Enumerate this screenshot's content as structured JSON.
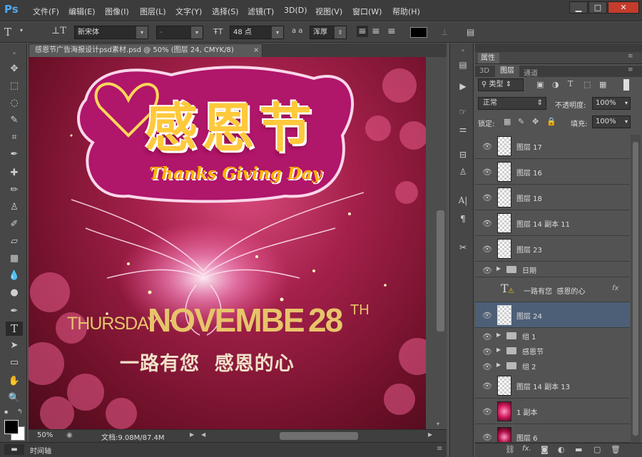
{
  "app": {
    "logo": "Ps"
  },
  "menu": [
    "文件(F)",
    "编辑(E)",
    "图像(I)",
    "图层(L)",
    "文字(Y)",
    "选择(S)",
    "滤镜(T)",
    "3D(D)",
    "视图(V)",
    "窗口(W)",
    "帮助(H)"
  ],
  "window": {
    "minimize": "▁",
    "maximize": "□",
    "close": "✕"
  },
  "options": {
    "font_family": "新宋体",
    "font_style": "-",
    "font_size": "48 点",
    "aa_label": "a a",
    "antialias": "浑厚",
    "color_swatch": "#000000"
  },
  "document": {
    "tab_title": "感恩节广告海报设计psd素材.psd @ 50% (图层 24, CMYK/8)",
    "tab_close": "×",
    "zoom": "50%",
    "doc_info": "文档:9.08M/87.4M"
  },
  "poster": {
    "main_title": "感恩节",
    "english_title": "Thanks Giving Day",
    "day": "THURSDAY",
    "month": "NOVEMBE",
    "date": "28",
    "date_suffix": "TH",
    "slogan": "一路有您  感恩的心"
  },
  "bottom": {
    "timeline": "时间轴"
  },
  "panel": {
    "properties_title": "属性",
    "tabs": [
      "3D",
      "图层",
      "通道"
    ],
    "kind_filter": "类型",
    "blend_mode": "正常",
    "opacity_label": "不透明度:",
    "opacity_value": "100%",
    "lock_label": "锁定:",
    "fill_label": "填充:",
    "fill_value": "100%"
  },
  "layers": [
    {
      "name": "图层 17",
      "kind": "pixel"
    },
    {
      "name": "图层 16",
      "kind": "pixel"
    },
    {
      "name": "图层 18",
      "kind": "pixel"
    },
    {
      "name": "图层 14 副本 11",
      "kind": "pixel"
    },
    {
      "name": "图层 23",
      "kind": "pixel"
    },
    {
      "name": "日期",
      "kind": "group"
    },
    {
      "name": "一路有您  感恩的心",
      "kind": "text",
      "fx": "fx"
    },
    {
      "name": "图层 24",
      "kind": "pixel",
      "selected": true
    },
    {
      "name": "组 1",
      "kind": "group"
    },
    {
      "name": "感恩节",
      "kind": "group"
    },
    {
      "name": "组 2",
      "kind": "group"
    },
    {
      "name": "图层 14 副本 13",
      "kind": "pixel"
    },
    {
      "name": "1 副本",
      "kind": "pixel"
    },
    {
      "name": "图层 6",
      "kind": "pixel"
    }
  ],
  "colors": {
    "accent": "#4d5f76",
    "poster_bg": "#a3204a",
    "gold": "#e7c46a"
  }
}
